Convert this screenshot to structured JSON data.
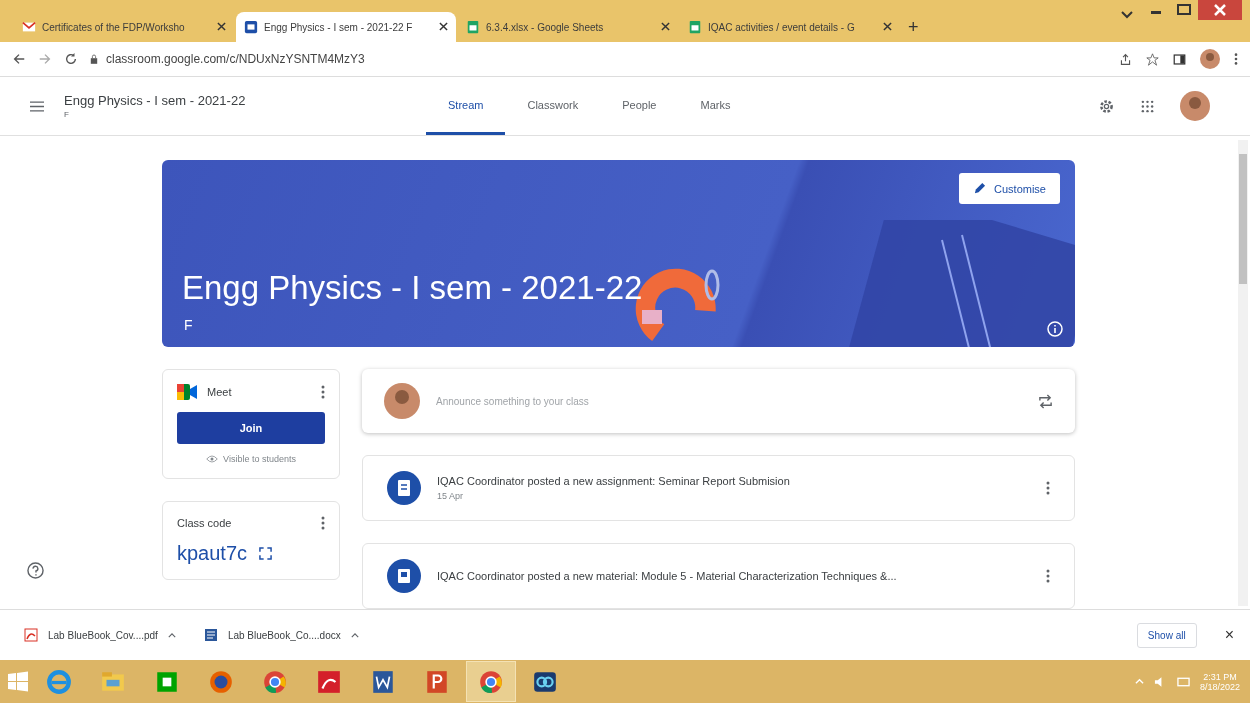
{
  "browser": {
    "tabs": [
      {
        "title": "Certificates of the FDP/Worksho",
        "kind": "mail",
        "selected": false
      },
      {
        "title": "Engg Physics - I sem - 2021-22 F",
        "kind": "classroom",
        "selected": true
      },
      {
        "title": "6.3.4.xlsx - Google Sheets",
        "kind": "sheets",
        "selected": false
      },
      {
        "title": "IQAC activities / event details - G",
        "kind": "sheets",
        "selected": false
      }
    ],
    "new_tab": "+",
    "url": "classroom.google.com/c/NDUxNzYSNTM4MzY3"
  },
  "class_header": {
    "title": "Engg Physics - I sem - 2021-22",
    "section": "F",
    "tabs": [
      {
        "label": "Stream",
        "selected": true
      },
      {
        "label": "Classwork",
        "selected": false
      },
      {
        "label": "People",
        "selected": false
      },
      {
        "label": "Marks",
        "selected": false
      }
    ]
  },
  "banner": {
    "title": "Engg Physics - I sem - 2021-22",
    "section": "F",
    "customise": "Customise"
  },
  "meet": {
    "title": "Meet",
    "join": "Join",
    "visibility": "Visible to students"
  },
  "class_code": {
    "label": "Class code",
    "code": "kpaut7c"
  },
  "announce": {
    "placeholder": "Announce something to your class"
  },
  "posts": [
    {
      "kind": "assignment",
      "text": "IQAC Coordinator posted a new assignment: Seminar Report Submision",
      "date": "15 Apr"
    },
    {
      "kind": "material",
      "text": "IQAC Coordinator posted a new material: Module 5 - Material Characterization Techniques &..."
    }
  ],
  "downloads": {
    "items": [
      {
        "kind": "pdf",
        "name": "Lab BlueBook_Cov....pdf"
      },
      {
        "kind": "doc",
        "name": "Lab BlueBook_Co....docx"
      }
    ],
    "show_all": "Show all",
    "close": "×"
  },
  "taskbar": {
    "apps": [
      {
        "kind": "ie",
        "active": false
      },
      {
        "kind": "explorer",
        "active": false
      },
      {
        "kind": "store",
        "active": false
      },
      {
        "kind": "firefox",
        "active": false
      },
      {
        "kind": "chrome",
        "active": false
      },
      {
        "kind": "acrobat",
        "active": false
      },
      {
        "kind": "word",
        "active": false
      },
      {
        "kind": "powerpoint",
        "active": false
      },
      {
        "kind": "chrome",
        "active": true
      },
      {
        "kind": "meeting",
        "active": false
      }
    ],
    "time": "2:31 PM",
    "date": "8/18/2022"
  }
}
